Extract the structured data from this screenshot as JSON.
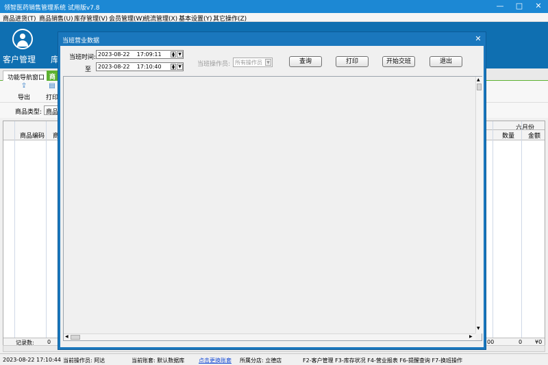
{
  "app": {
    "title": "领智医药销售管理系统 试用版v7.8",
    "min_icon": "minimize-icon",
    "max_icon": "maximize-icon",
    "close_icon": "close-icon"
  },
  "menu": [
    "商品进货(T)",
    "商品销售(U)",
    "库存管理(V)",
    "会员管理(W)",
    "统流管理(X)",
    "基本设置(Y)",
    "其它操作(Z)"
  ],
  "ribbon": {
    "customer_label": "客户管理",
    "inventory_label": "库"
  },
  "tabs": {
    "nav": "功能导航窗口",
    "green": "商"
  },
  "toolbar": {
    "export_label": "导出",
    "print_label": "打印"
  },
  "filter": {
    "category_label": "商品类型:",
    "category_value": "商品"
  },
  "grid": {
    "col_code": "商品编码",
    "col_partial": "商",
    "group_june": "六月份",
    "col_qty": "数量",
    "col_amount": "金额",
    "footer_label": "记录数:",
    "footer_count": "0",
    "footer_qty_partial": "00",
    "footer_qty": "0",
    "footer_amount_partial": "¥0"
  },
  "dialog": {
    "title": "当班营业数据",
    "time_label": "当班时间:",
    "to_label": "至",
    "start_date": "2023-08-22",
    "start_time": "17:09:11",
    "end_date": "2023-08-22",
    "end_time": "17:10:40",
    "operator_label": "当班操作员:",
    "operator_value": "所有操作员",
    "query_button": "查询",
    "print_button": "打印",
    "start_shift_button": "开始交班",
    "exit_button": "退出"
  },
  "status": {
    "datetime": "2023-08-22 17:10:44",
    "operator": "当前操作员: 阿达",
    "account": "当前账套: 默认数据库",
    "switch_link": "点击更换账套",
    "branch": "所属分店: 立德店",
    "shortcuts": "F2-客户管理 F3-库存状况 F4-营业报表 F6-提醒查询 F7-换班操作"
  },
  "colors": {
    "title_bar": "#1c88d4",
    "ribbon": "#0f6fb1",
    "green_tab": "#5cb130",
    "link": "#1a4ed6"
  }
}
